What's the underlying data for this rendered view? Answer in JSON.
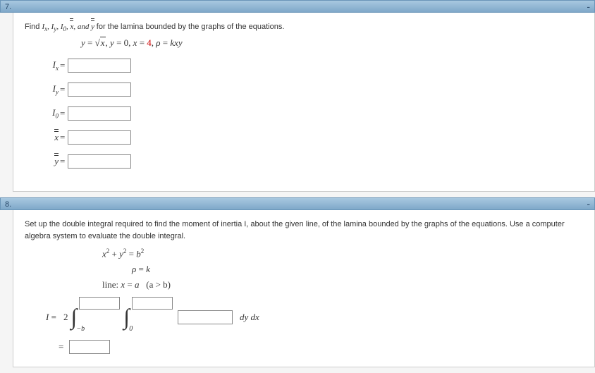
{
  "q7": {
    "number": "7.",
    "prompt_prefix": "Find ",
    "prompt_suffix": " for the lamina bounded by the graphs of the equations.",
    "terms": {
      "ix": "I",
      "ixs": "x",
      "iy": "I",
      "iys": "y",
      "i0": "I",
      "i0s": "0",
      "xbb": "x",
      "ybb": "y",
      "and": ", and "
    },
    "eqline": {
      "y": "y",
      "eq": " = ",
      "sqrt_x": "x",
      "c1": ", ",
      "y0": "y",
      "v0": "0",
      "c2": ", ",
      "x": "x",
      "v4": "4",
      "c3": ", ",
      "rho": "ρ",
      "kxy": "kxy"
    },
    "rows": {
      "ix_label": "I",
      "ix_sub": "x",
      "iy_label": "I",
      "iy_sub": "y",
      "i0_label": "I",
      "i0_sub": "0",
      "xbb": "x",
      "ybb": "y"
    }
  },
  "q8": {
    "number": "8.",
    "prompt": "Set up the double integral required to find the moment of inertia I, about the given line, of the lamina bounded by the graphs of the equations. Use a computer algebra system to evaluate the double integral.",
    "eq": {
      "l1_l": "x",
      "l1_p": " + ",
      "l1_r": "y",
      "l1_eq": " = ",
      "l1_b": "b",
      "l2_l": "ρ",
      "l2_eq": " = ",
      "l2_r": "k",
      "l3_pre": "line: ",
      "l3_l": "x",
      "l3_eq": " = ",
      "l3_r": "a",
      "l3_cond": "(a > b)"
    },
    "int": {
      "I": "I",
      "eq": "=",
      "coef": "2",
      "low1": "−b",
      "low2": "0",
      "dydx": "dy dx"
    }
  }
}
